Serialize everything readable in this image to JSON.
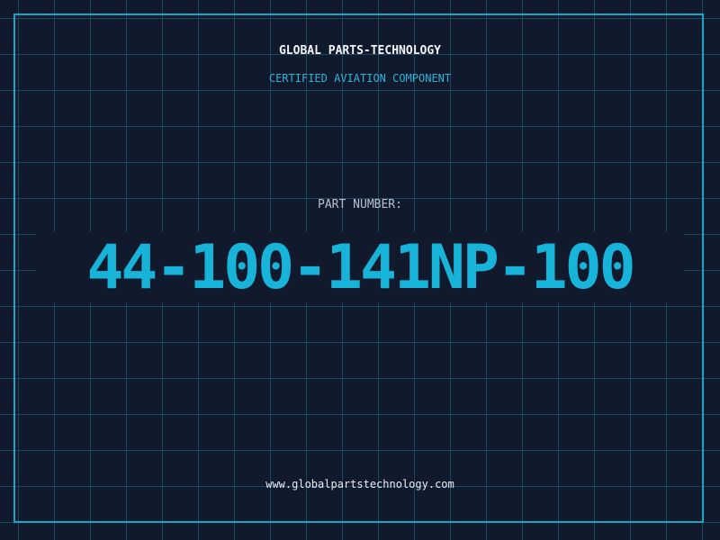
{
  "header": {
    "company": "GLOBAL PARTS-TECHNOLOGY",
    "subtitle": "CERTIFIED AVIATION COMPONENT"
  },
  "part": {
    "label": "PART NUMBER:",
    "number": "44-100-141NP-100"
  },
  "footer": {
    "website": "www.globalpartstechnology.com"
  },
  "colors": {
    "background": "#111a2d",
    "grid": "#226e8c",
    "border": "#17a7c6",
    "accent": "#17b3d8"
  }
}
